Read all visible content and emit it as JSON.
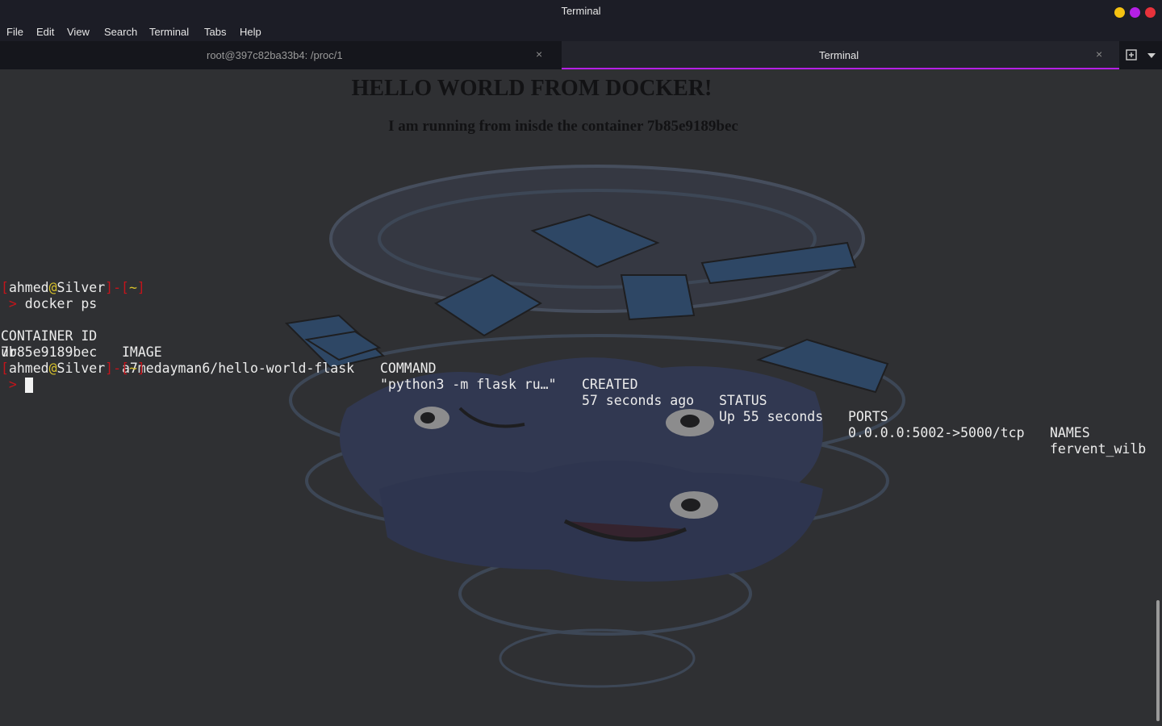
{
  "window": {
    "title": "Terminal",
    "controls": [
      {
        "name": "minimize",
        "color": "#f5c211"
      },
      {
        "name": "maximize",
        "color": "#b520e6"
      },
      {
        "name": "close",
        "color": "#e8323b"
      }
    ]
  },
  "menu": [
    "File",
    "Edit",
    "View",
    "Search",
    "Terminal",
    "Tabs",
    "Help"
  ],
  "tabs": [
    {
      "label": "root@397c82ba33b4: /proc/1",
      "active": false,
      "close": "×"
    },
    {
      "label": "Terminal",
      "active": true,
      "close": "×"
    }
  ],
  "tab_tools": {
    "new_tab_icon": "new-tab-icon",
    "menu_icon": "dropdown-arrow-icon"
  },
  "background_page": {
    "heading": "HELLO WORLD FROM DOCKER!",
    "subheading": "I am running from inisde the container 7b85e9189bec"
  },
  "terminal": {
    "prompt1": {
      "open": "[",
      "user": "ahmed",
      "at": "@",
      "host": "Silver",
      "close": "]",
      "sep": "-",
      "dir_open": "[",
      "dir": "~",
      "dir_close": "]"
    },
    "arrow": " >",
    "command": " docker ps",
    "headers": [
      "CONTAINER ID",
      "IMAGE",
      "COMMAND",
      "CREATED",
      "STATUS",
      "PORTS",
      "NAMES"
    ],
    "row": [
      "7b85e9189bec",
      "a7medayman6/hello-world-flask",
      "\"python3 -m flask ru…\"",
      "57 seconds ago",
      "Up 55 seconds",
      "0.0.0.0:5002->5000/tcp",
      "fervent_wilb"
    ],
    "row_wrap": "ur",
    "prompt2": {
      "open": "[",
      "user": "ahmed",
      "at": "@",
      "host": "Silver",
      "close": "]",
      "sep": "-",
      "dir_open": "[",
      "dir": "~",
      "dir_close": "]"
    },
    "arrow2": " >"
  }
}
